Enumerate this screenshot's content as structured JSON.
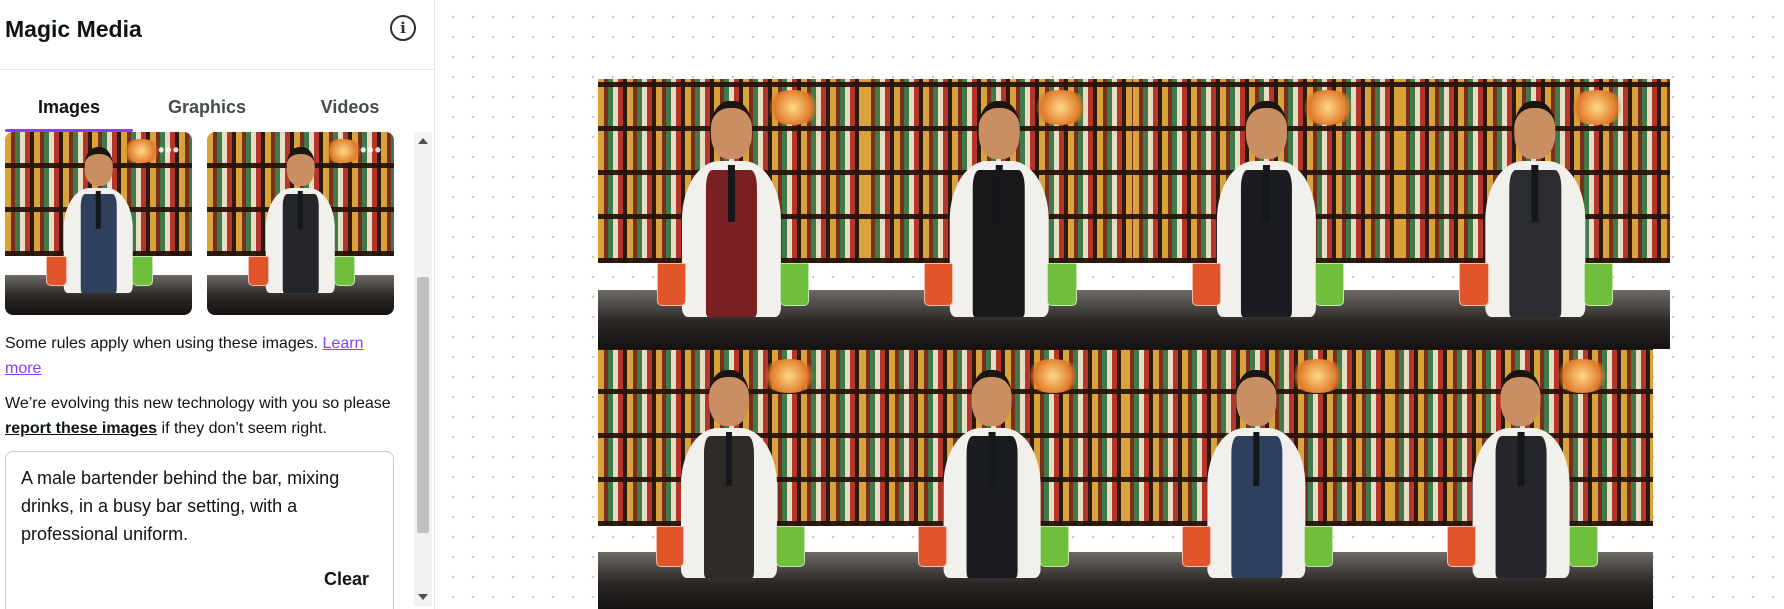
{
  "panel": {
    "title": "Magic Media",
    "info_icon": "info-icon",
    "tabs": [
      {
        "label": "Images",
        "active": true
      },
      {
        "label": "Graphics",
        "active": false
      },
      {
        "label": "Videos",
        "active": false
      }
    ],
    "rules_text": "Some rules apply when using these images. ",
    "rules_link": "Learn more",
    "evolve_prefix": "We’re evolving this new technology with you so please ",
    "evolve_link": "report these images",
    "evolve_suffix": " if they don’t seem right.",
    "prompt": "A male bartender behind the bar, mixing drinks, in a busy bar setting, with a professional uniform.",
    "clear_label": "Clear",
    "thumbnail_more_icon": "more-options-icon"
  },
  "colors": {
    "accent": "#8b3dff",
    "text": "#0e1318",
    "canvas_dot": "#c9cbd0"
  },
  "canvas": {
    "images": [
      {
        "name": "bartender-image-1",
        "vest": "#7a1f22"
      },
      {
        "name": "bartender-image-2",
        "vest": "#18181a"
      },
      {
        "name": "bartender-image-3",
        "vest": "#1a1c22"
      },
      {
        "name": "bartender-image-4",
        "vest": "#2b2c30"
      },
      {
        "name": "bartender-image-5",
        "vest": "#2e2a28"
      },
      {
        "name": "bartender-image-6",
        "vest": "#1a1c22"
      },
      {
        "name": "bartender-image-7",
        "vest": "#2f3f5e"
      },
      {
        "name": "bartender-image-8",
        "vest": "#24262b"
      }
    ]
  }
}
